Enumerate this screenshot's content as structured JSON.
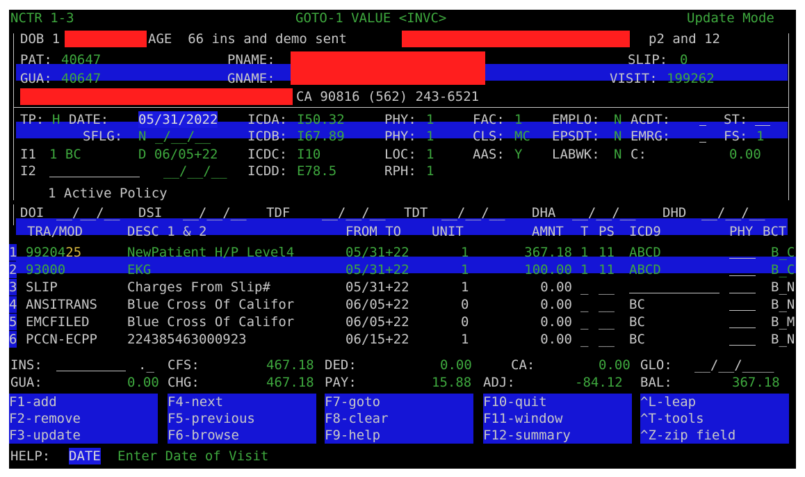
{
  "title_bar": {
    "left": "NCTR 1-3",
    "center": "GOTO-1 VALUE <INVC>",
    "right": "Update Mode"
  },
  "banner": {
    "dob_label": "DOB 1",
    "age_text": "AGE  66 ins and demo sent",
    "right_text": "p2 and 12"
  },
  "patient": {
    "pat_label": "PAT:",
    "pat_value": "40647",
    "pname_label": "PNAME:",
    "slip_label": "SLIP:",
    "slip_value": "0",
    "gua_label": "GUA:",
    "gua_value": "40647",
    "gname_label": "GNAME:",
    "visit_label": "VISIT:",
    "visit_value": "199262"
  },
  "address_bar": {
    "text": "CA 90816 (562) 243-6521"
  },
  "visit": {
    "tp_label": "TP:",
    "tp_value": "H",
    "date_label": "DATE:",
    "date_value": "05/31/2022",
    "icda_label": "ICDA:",
    "icda_value": "I50.32",
    "phy1_label": "PHY:",
    "phy1_value": "1",
    "fac_label": "FAC:",
    "fac_value": "1",
    "emplo_label": "EMPLO:",
    "emplo_value": "N",
    "acdt_label": "ACDT:",
    "st_label": "ST:",
    "sflg_label": "SFLG:",
    "sflg_value": "N",
    "icdb_label": "ICDB:",
    "icdb_value": "I67.89",
    "phy2_label": "PHY:",
    "phy2_value": "1",
    "cls_label": "CLS:",
    "cls_value": "MC",
    "epsdt_label": "EPSDT:",
    "epsdt_value": "N",
    "emrg_label": "EMRG:",
    "fs_label": "FS:",
    "fs_value": "1",
    "i1_label": "I1",
    "i1_value": "1 BC",
    "i1_d": "D 06/05+22",
    "icdc_label": "ICDC:",
    "icdc_value": "I10",
    "loc_label": "LOC:",
    "loc_value": "1",
    "aas_label": "AAS:",
    "aas_value": "Y",
    "labwk_label": "LABWK:",
    "labwk_value": "N",
    "c_label": "C:",
    "c_value": "0.00",
    "i2_label": "I2",
    "icdd_label": "ICDD:",
    "icdd_value": "E78.5",
    "rph_label": "RPH:",
    "rph_value": "1"
  },
  "policy_bar": "1 Active Policy",
  "dates_row": {
    "doi": "DOI",
    "dsi": "DSI",
    "tdf": "TDF",
    "tdt": "TDT",
    "dha": "DHA",
    "dhd": "DHD"
  },
  "table": {
    "headers": {
      "tra": "TRA/MOD",
      "desc": "DESC 1 & 2",
      "fromto": "FROM TO",
      "unit": "UNIT",
      "amnt": "AMNT",
      "t": "T",
      "ps": "PS",
      "icd9": "ICD9",
      "phy": "PHY",
      "bct": "BCT"
    },
    "rows": [
      {
        "n": "1",
        "code": "99204",
        "mod": "25",
        "desc": "NewPatient H/P Level4",
        "date": "05/31+22",
        "unit": "1",
        "amnt": "367.18",
        "t": "1",
        "ps": "11",
        "icd": "ABCD",
        "bct": "B_C"
      },
      {
        "n": "2",
        "code": "93000",
        "mod": "",
        "desc": "EKG",
        "date": "05/31+22",
        "unit": "1",
        "amnt": "100.00",
        "t": "1",
        "ps": "11",
        "icd": "ABCD",
        "bct": "B_C"
      },
      {
        "n": "3",
        "code": "SLIP",
        "mod": "",
        "desc": "Charges From Slip#",
        "date": "05/31+22",
        "unit": "1",
        "amnt": "0.00",
        "t": "_",
        "ps": "__",
        "icd": "",
        "bct": "B_N"
      },
      {
        "n": "4",
        "code": "ANSITRANS",
        "mod": "",
        "desc": "Blue Cross Of Califor",
        "date": "06/05+22",
        "unit": "0",
        "amnt": "0.00",
        "t": "_",
        "ps": "__",
        "icd": "BC",
        "bct": "B_N"
      },
      {
        "n": "5",
        "code": "EMCFILED",
        "mod": "",
        "desc": "Blue Cross Of Califor",
        "date": "06/05+22",
        "unit": "0",
        "amnt": "0.00",
        "t": "_",
        "ps": "__",
        "icd": "BC",
        "bct": "B_M"
      },
      {
        "n": "6",
        "code": "PCCN-ECPP",
        "mod": "",
        "desc": "224385463000923",
        "date": "06/15+22",
        "unit": "1",
        "amnt": "0.00",
        "t": "_",
        "ps": "__",
        "icd": "BC",
        "bct": "B_N"
      }
    ]
  },
  "totals": {
    "ins_label": "INS:",
    "ins_value": "._",
    "cfs_label": "CFS:",
    "cfs_value": "467.18",
    "ded_label": "DED:",
    "ded_value": "0.00",
    "ca_label": "CA:",
    "ca_value": "0.00",
    "glo_label": "GLO:",
    "gua_label": "GUA:",
    "gua_value": "0.00",
    "chg_label": "CHG:",
    "chg_value": "467.18",
    "pay_label": "PAY:",
    "pay_value": "15.88",
    "adj_label": "ADJ:",
    "adj_value": "-84.12",
    "bal_label": "BAL:",
    "bal_value": "367.18"
  },
  "fkeys": [
    [
      "F1-add",
      "F4-next",
      "F7-goto",
      "F10-quit",
      "^L-leap"
    ],
    [
      "F2-remove",
      "F5-previous",
      "F8-clear",
      "F11-window",
      "^T-tools"
    ],
    [
      "F3-update",
      "F6-browse",
      "F9-help",
      "F12-summary",
      "^Z-zip field"
    ]
  ],
  "help": {
    "label": "HELP:",
    "field": "DATE",
    "text": "Enter Date of Visit"
  },
  "colors": {
    "background": "#000000",
    "label": "#c8c8c8",
    "value": "#3ea83e",
    "highlight_bar": "#1515d6",
    "redaction": "#ff1e1e",
    "modifier": "#d8b840"
  }
}
